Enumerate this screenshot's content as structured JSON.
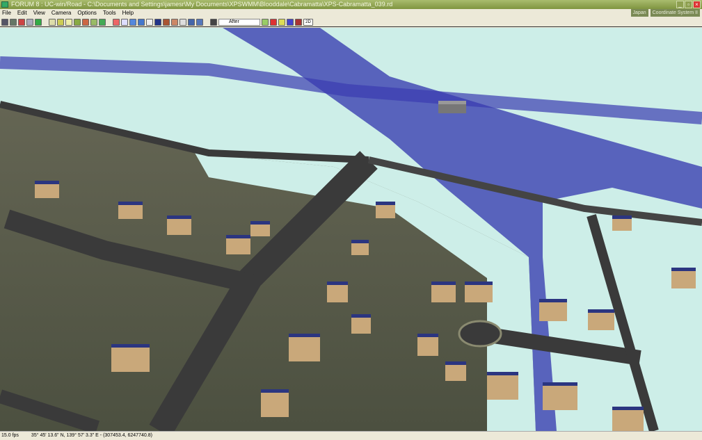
{
  "window": {
    "title": "FORUM 8 : UC-win/Road - C:\\Documents and Settings\\jamesr\\My Documents\\XPSWMM\\Blooddale\\Cabramatta\\XPS-Cabramatta_039.rd"
  },
  "menu": [
    "File",
    "Edit",
    "View",
    "Camera",
    "Options",
    "Tools",
    "Help"
  ],
  "right_buttons": [
    "Japan",
    "Coordinate System II"
  ],
  "toolbar": {
    "scenario_select": "After",
    "mode_2d": "2D"
  },
  "status": {
    "fps": "15.0 fps",
    "latlon": "35° 45' 13.6\" N, 139° 57' 3.3\" E",
    "coords": "(307453.4, 6247740.8)"
  },
  "colors": {
    "flood_deep": "#2b2fa0",
    "flood_shallow": "#cdeee8",
    "road": "#3a3a3a",
    "terrain": "#5a5c44"
  }
}
